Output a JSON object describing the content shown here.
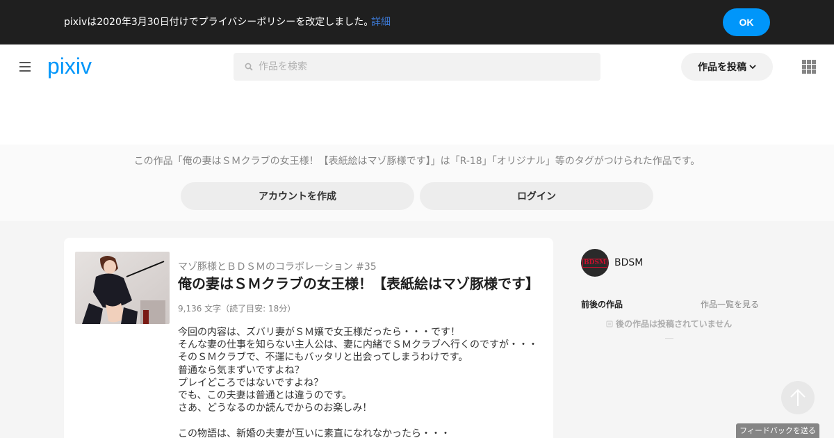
{
  "banner": {
    "message": "pixivは2020年3月30日付けでプライバシーポリシーを改定しました。",
    "link": "詳細",
    "ok_label": "OK"
  },
  "header": {
    "logo": "pixiv",
    "search_placeholder": "作品を検索",
    "post_label": "作品を投稿",
    "colors": {
      "logo": "#0096fa",
      "accent": "#0096fa"
    }
  },
  "promo": {
    "text": "この作品「俺の妻はＳＭクラブの女王様！【表紙絵はマゾ豚様です】」は「R-18」「オリジナル」等のタグがつけられた作品です。",
    "create_label": "アカウントを作成",
    "login_label": "ログイン"
  },
  "work": {
    "series": "マゾ豚様とＢＤＳＭのコラボレーション #35",
    "title": "俺の妻はＳＭクラブの女王様！【表紙絵はマゾ豚様です】",
    "meta": "9,136 文字（読了目安: 18分）",
    "description": [
      "今回の内容は、ズバリ妻がＳＭ嬢で女王様だったら・・・です！",
      "そんな妻の仕事を知らない主人公は、妻に内緒でＳＭクラブへ行くのですが・・・",
      "そのＳＭクラブで、不運にもバッタリと出会ってしまうわけです。",
      "普通なら気まずいですよね？",
      "プレイどころではないですよね？",
      "でも、この夫妻は普通とは違うのです。",
      "さあ、どうなるのか読んでからのお楽しみ！",
      "",
      "この物語は、新婚の夫妻が互いに素直になれなかったら・・・"
    ]
  },
  "sidebar": {
    "avatar_text": "BDSM",
    "username": "BDSM",
    "prev_next_label": "前後の作品",
    "list_link": "作品一覧を見る",
    "no_next": "後の作品は投稿されていません"
  },
  "footer": {
    "feedback_label": "フィードバックを送る"
  }
}
